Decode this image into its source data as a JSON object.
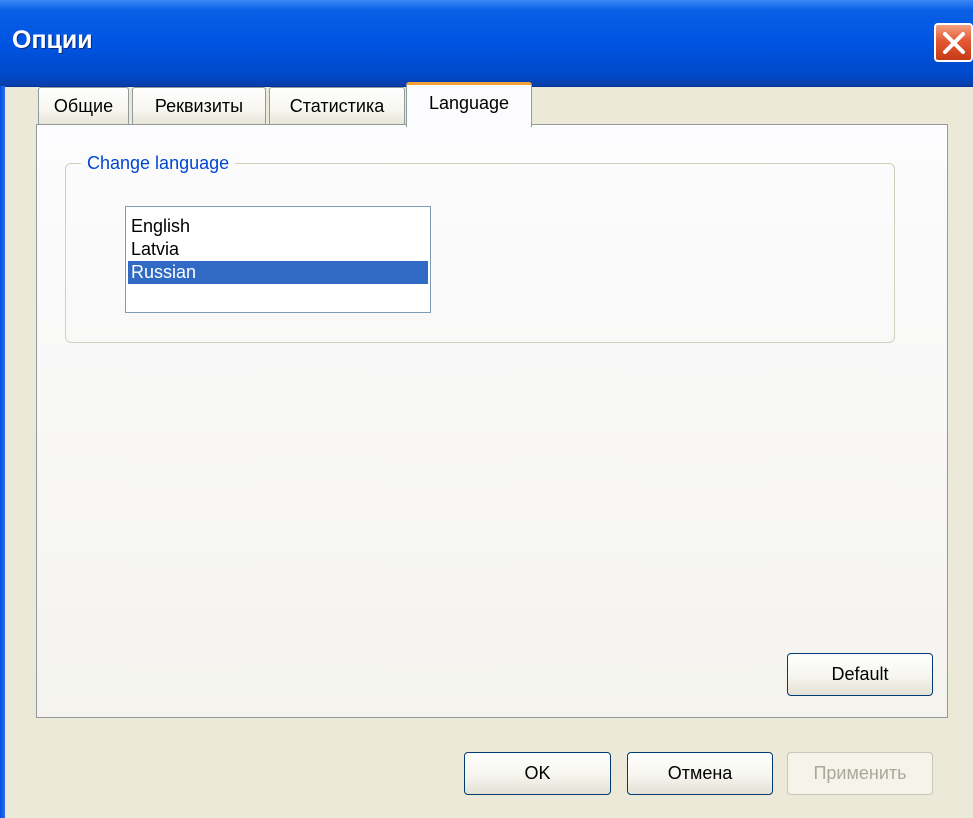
{
  "window": {
    "title": "Опции"
  },
  "tabs": [
    {
      "label": "Общие"
    },
    {
      "label": "Реквизиты"
    },
    {
      "label": "Статистика"
    },
    {
      "label": "Language"
    }
  ],
  "active_tab": "Language",
  "language_group": {
    "legend": "Change language",
    "options": [
      "English",
      "Latvia",
      "Russian"
    ],
    "selected": "Russian"
  },
  "buttons": {
    "default": "Default",
    "ok": "OK",
    "cancel": "Отмена",
    "apply": "Применить"
  },
  "colors": {
    "titlebar": "#0054e3",
    "selection": "#316ac5",
    "legend_text": "#0046d5",
    "active_tab_highlight": "#f3a23a"
  }
}
